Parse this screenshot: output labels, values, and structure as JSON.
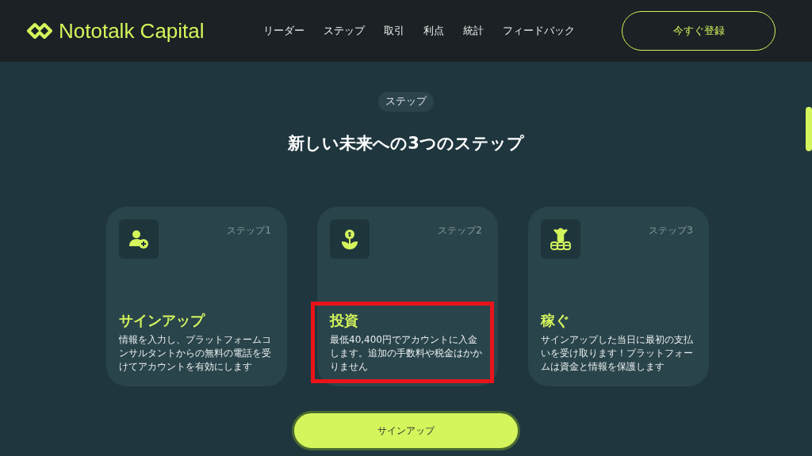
{
  "header": {
    "logo": "Nototalk Capital",
    "nav": [
      {
        "label": "リーダー"
      },
      {
        "label": "ステップ"
      },
      {
        "label": "取引"
      },
      {
        "label": "利点"
      },
      {
        "label": "統計"
      },
      {
        "label": "フィードバック"
      }
    ],
    "register_button": "今すぐ登録"
  },
  "section": {
    "badge": "ステップ",
    "heading": "新しい未来への3つのステップ"
  },
  "steps": [
    {
      "kind": "user",
      "step": "ステップ1",
      "title": "サインアップ",
      "description": "情報を入力し、プラットフォームコンサルタントからの無料の電話を受けてアカウントを有効にします",
      "highlighted": false
    },
    {
      "kind": "flower",
      "step": "ステップ2",
      "title": "投資",
      "description": "最低40,400円でアカウントに入金します。追加の手数料や税金はかかりません",
      "highlighted": true
    },
    {
      "kind": "coins",
      "step": "ステップ3",
      "title": "稼ぐ",
      "description": "サインアップした当日に最初の支払いを受け取ります！プラットフォームは資金と情報を保護します",
      "highlighted": false
    }
  ],
  "cta_button": "サインアップ"
}
